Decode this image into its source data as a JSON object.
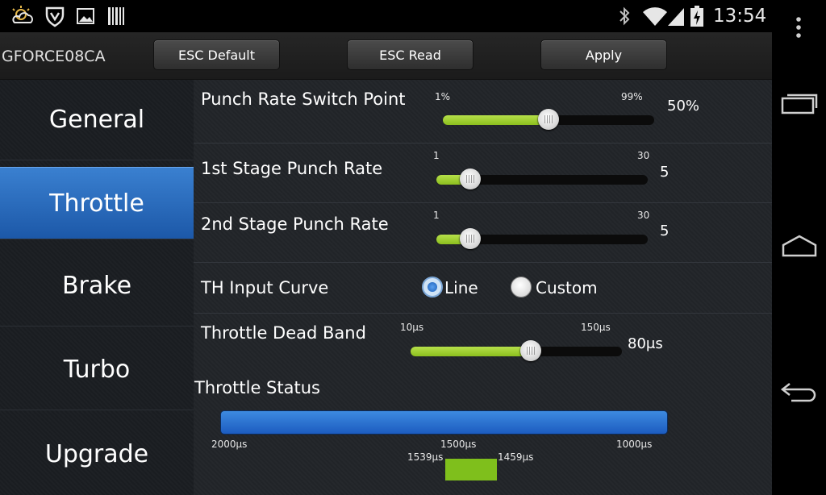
{
  "header": {
    "app_title": "GFORCE08CA",
    "esc_default_label": "ESC Default",
    "esc_read_label": "ESC Read",
    "apply_label": "Apply"
  },
  "status": {
    "time": "13:54"
  },
  "sidebar": {
    "items": [
      {
        "label": "General"
      },
      {
        "label": "Throttle"
      },
      {
        "label": "Brake"
      },
      {
        "label": "Turbo"
      },
      {
        "label": "Upgrade"
      }
    ],
    "selected": "Throttle"
  },
  "settings": {
    "punch_switch": {
      "label": "Punch Rate Switch Point",
      "min": "1%",
      "max": "99%",
      "value": "50%",
      "level": 0.5
    },
    "stage1": {
      "label": "1st Stage Punch Rate",
      "min": "1",
      "max": "30",
      "value": "5",
      "level": 0.16
    },
    "stage2": {
      "label": "2nd Stage Punch Rate",
      "min": "1",
      "max": "30",
      "value": "5",
      "level": 0.16
    },
    "input_curve": {
      "label": "TH Input Curve",
      "option_line": "Line",
      "option_custom": "Custom",
      "selected": "Line"
    },
    "dead_band": {
      "label": "Throttle Dead Band",
      "min": "10μs",
      "max": "150μs",
      "value": "80μs",
      "level": 0.57
    }
  },
  "throttle_status": {
    "label": "Throttle Status",
    "left_label": "2000μs",
    "center_label": "1500μs",
    "right_label": "1000μs",
    "indicator_left": "1539μs",
    "indicator_right": "1459μs"
  },
  "colors": {
    "accent_blue": "#2a6fcf",
    "slider_green": "#9ccc2a"
  },
  "icons": [
    "weather-icon",
    "shield-icon",
    "image-icon",
    "barcode-icon",
    "bluetooth-icon",
    "wifi-icon",
    "signal-icon",
    "battery-icon",
    "overflow-menu-icon",
    "recent-apps-icon",
    "home-icon",
    "back-icon"
  ]
}
